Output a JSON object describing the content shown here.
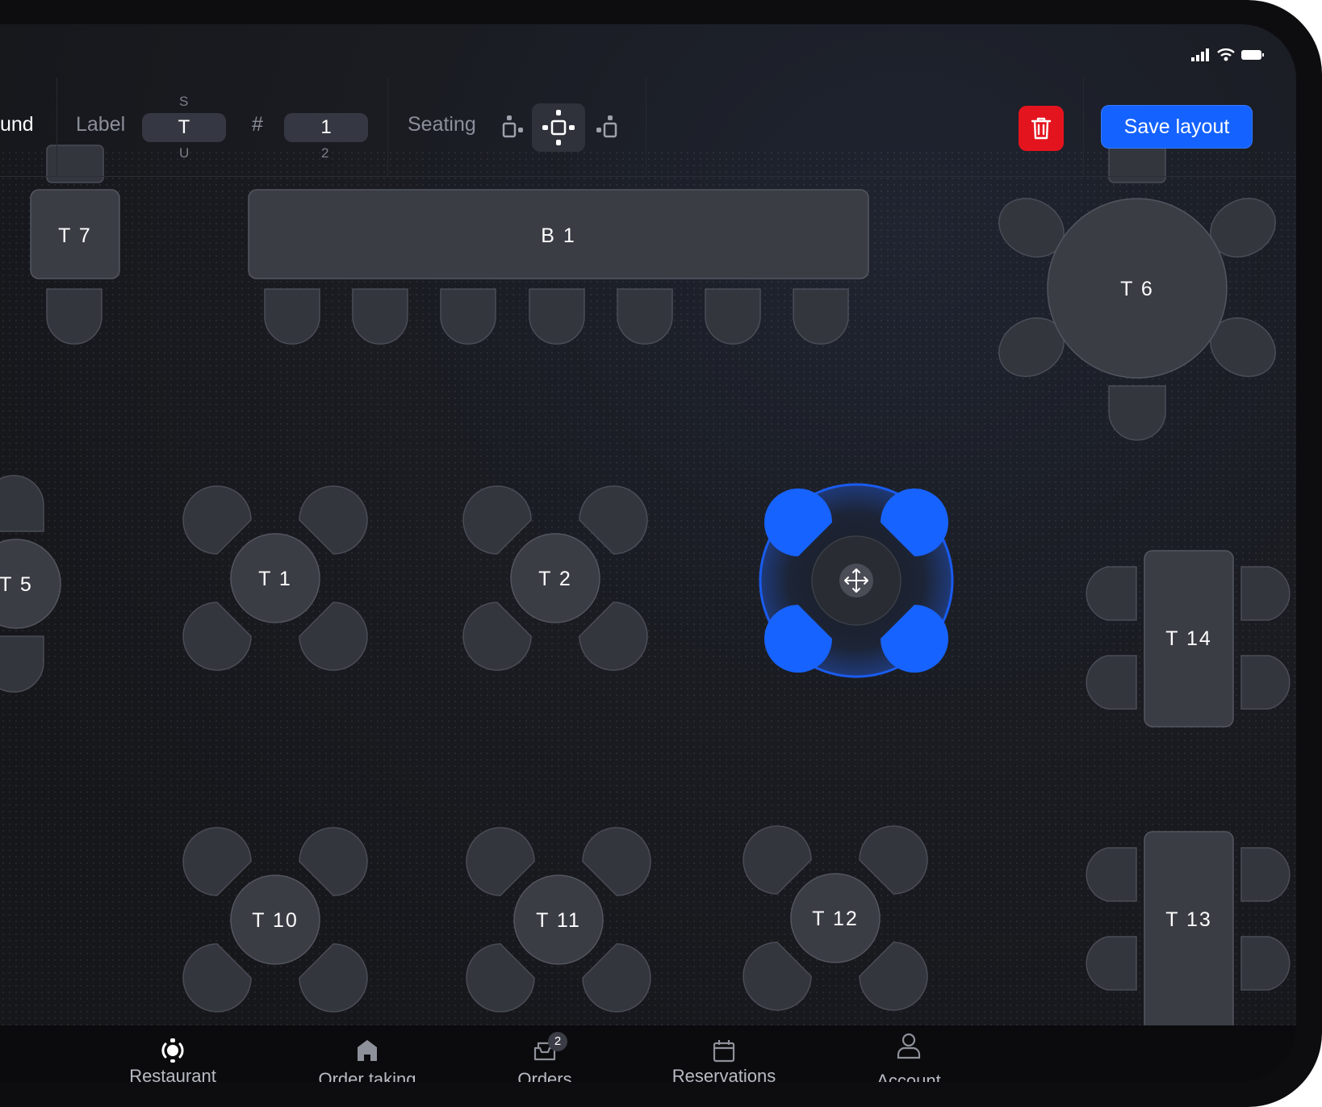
{
  "status_bar": {
    "signal_icon": "signal-icon",
    "wifi_icon": "wifi-icon",
    "battery_icon": "battery-icon"
  },
  "toolbar": {
    "partial_label": "und",
    "label_caption": "Label",
    "label_value": "T",
    "label_prev": "S",
    "label_next": "U",
    "number_caption": "#",
    "number_value": "1",
    "number_next": "2",
    "seating_caption": "Seating",
    "seating_options": [
      "seating-left-icon",
      "seating-all-sides-icon",
      "seating-right-icon"
    ],
    "seating_selected": "seating-all-sides-icon",
    "delete_icon": "trash-icon",
    "save_label": "Save layout"
  },
  "floor_plan": {
    "tables": [
      {
        "id": "T7",
        "label": "T 7",
        "shape": "rect"
      },
      {
        "id": "B1",
        "label": "B 1",
        "shape": "bar"
      },
      {
        "id": "T6",
        "label": "T 6",
        "shape": "round"
      },
      {
        "id": "T5",
        "label": "T 5",
        "shape": "round"
      },
      {
        "id": "T1",
        "label": "T 1",
        "shape": "round"
      },
      {
        "id": "T2",
        "label": "T 2",
        "shape": "round"
      },
      {
        "id": "selected",
        "label": "",
        "shape": "round",
        "selected": true,
        "icon": "move-icon"
      },
      {
        "id": "T14",
        "label": "T 14",
        "shape": "rect"
      },
      {
        "id": "T10",
        "label": "T 10",
        "shape": "round"
      },
      {
        "id": "T11",
        "label": "T 11",
        "shape": "round"
      },
      {
        "id": "T12",
        "label": "T 12",
        "shape": "round"
      },
      {
        "id": "T13",
        "label": "T 13",
        "shape": "rect"
      }
    ],
    "colors": {
      "table": "#3b3d45",
      "seat": "#34363e",
      "selected": "#1763ff"
    }
  },
  "bottom_nav": {
    "items": [
      {
        "label": "Restaurant",
        "icon": "restaurant-icon"
      },
      {
        "label": "Order taking",
        "icon": "home-icon"
      },
      {
        "label": "Orders",
        "icon": "orders-icon",
        "badge": "2"
      },
      {
        "label": "Reservations",
        "icon": "calendar-icon"
      },
      {
        "label": "Account",
        "icon": "user-icon"
      }
    ]
  }
}
